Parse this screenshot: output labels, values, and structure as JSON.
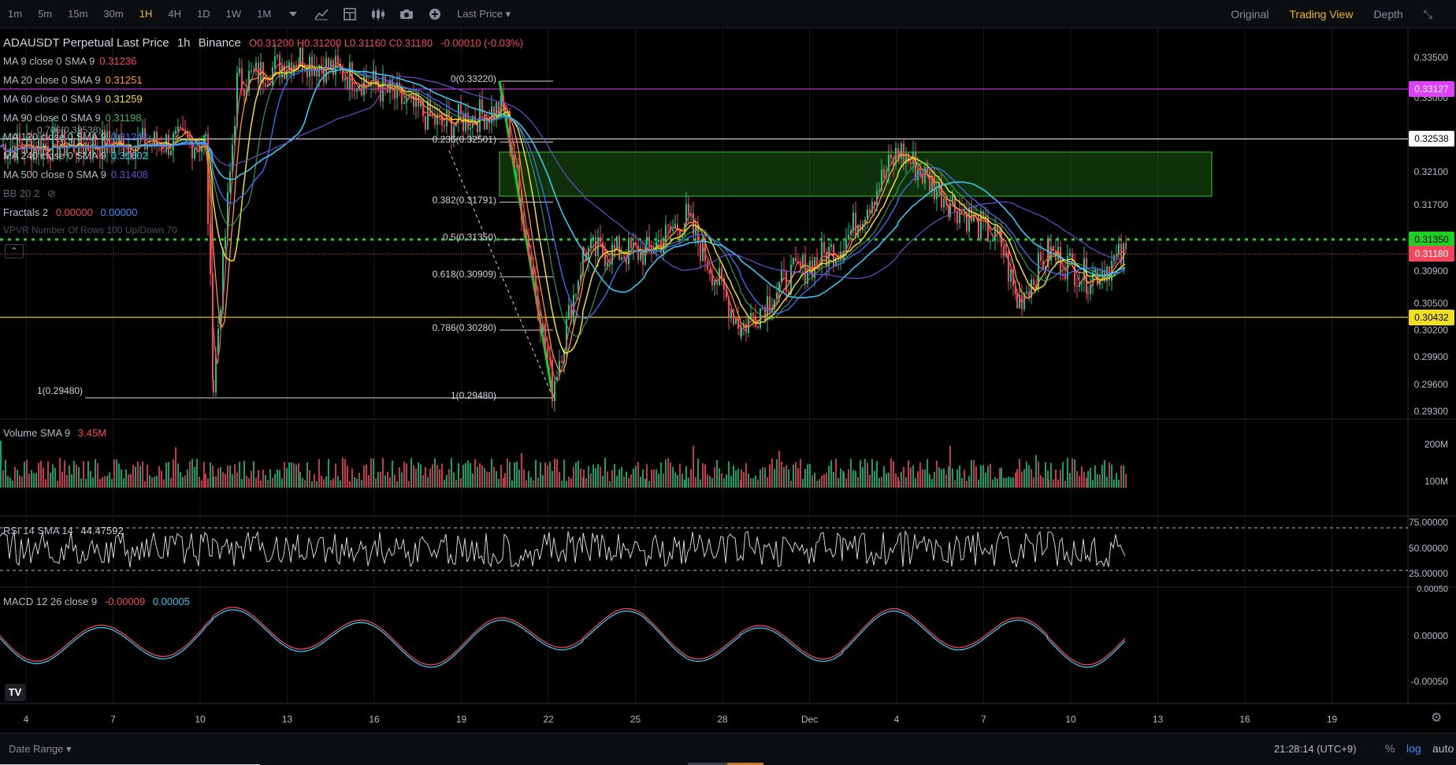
{
  "toolbar": {
    "timeframes": [
      "1m",
      "5m",
      "15m",
      "30m",
      "1H",
      "4H",
      "1D",
      "1W",
      "1M"
    ],
    "active_timeframe": "1H",
    "price_type": "Last Price",
    "views": [
      "Original",
      "Trading View",
      "Depth"
    ],
    "active_view": "Trading View"
  },
  "header": {
    "symbol": "ADAUSDT Perpetual Last Price",
    "interval": "1h",
    "exchange": "Binance",
    "ohlc": "O0.31200 H0.31200 L0.31160 C0.31180",
    "change": "-0.00010 (-0.03%)"
  },
  "legends": [
    {
      "label": "MA 9 close 0 SMA 9",
      "value": "0.31236",
      "color": "#f6465d"
    },
    {
      "label": "MA 20 close 0 SMA 9",
      "value": "0.31251",
      "color": "#ff9a1f"
    },
    {
      "label": "MA 60 close 0 SMA 9",
      "value": "0.31259",
      "color": "#f0e020"
    },
    {
      "label": "MA 90 close 0 SMA 9",
      "value": "0.31198",
      "color": "#37b45a"
    },
    {
      "label": "MA 120 close 0 SMA 9",
      "value": "0.31243",
      "color": "#3b6cf0"
    },
    {
      "label": "MA 240 close 0 SMA 9",
      "value": "0.31602",
      "color": "#33c9f0"
    },
    {
      "label": "MA 500 close 0 SMA 9",
      "value": "0.31408",
      "color": "#6a4fd0"
    }
  ],
  "bb_label": "BB 20 2",
  "fractals": {
    "label": "Fractals 2",
    "v1": "0.00000",
    "v2": "0.00000"
  },
  "vpvr_label": "VPVR Number Of Rows 100 Up/Down 70",
  "fib_left": [
    {
      "label": "0.786(0.32538)"
    },
    {
      "label": "1(0.29480)"
    }
  ],
  "fib": [
    {
      "label": "0(0.33220)",
      "price": 0.3322
    },
    {
      "label": "0.236(0.32501)",
      "price": 0.32501
    },
    {
      "label": "0.382(0.31791)",
      "price": 0.31791
    },
    {
      "label": "0.5(0.31350)",
      "price": 0.3135
    },
    {
      "label": "0.618(0.30909)",
      "price": 0.30909
    },
    {
      "label": "0.786(0.30280)",
      "price": 0.3028
    },
    {
      "label": "1(0.29480)",
      "price": 0.2948
    }
  ],
  "price_axis": [
    "0.33500",
    "0.33000",
    "0.32100",
    "0.31700",
    "0.30900",
    "0.30500",
    "0.30200",
    "0.29900",
    "0.29600",
    "0.29300"
  ],
  "price_tags": [
    {
      "text": "0.33127",
      "bg": "#e040fb",
      "color": "#ffffff",
      "price": 0.33127
    },
    {
      "text": "0.32538",
      "bg": "#ffffff",
      "color": "#000000",
      "price": 0.32538
    },
    {
      "text": "0.31350",
      "bg": "#20d020",
      "color": "#000000",
      "price": 0.3135
    },
    {
      "text": "0.31180",
      "bg": "#f6465d",
      "color": "#ffffff",
      "price": 0.3118
    },
    {
      "text": "0.30432",
      "bg": "#f0e020",
      "color": "#000000",
      "price": 0.30432
    }
  ],
  "volume": {
    "label": "Volume SMA 9",
    "value": "3.45M",
    "axis": [
      "200M",
      "100M"
    ]
  },
  "rsi": {
    "label": "RSI 14 SMA 14",
    "value": "44.47592",
    "axis": [
      "75.00000",
      "50.00000",
      "25.00000"
    ]
  },
  "macd": {
    "label": "MACD 12 26 close 9",
    "v1": "-0.00009",
    "v2": "0.00005",
    "axis": [
      "0.00000",
      "-0.00050"
    ],
    "top_axis": "0.00050"
  },
  "x_axis": [
    "4",
    "7",
    "10",
    "13",
    "16",
    "19",
    "22",
    "25",
    "28",
    "Dec",
    "4",
    "7",
    "10",
    "13",
    "16",
    "19"
  ],
  "bottom": {
    "date_range": "Date Range",
    "clock": "21:28:14 (UTC+9)",
    "pct": "%",
    "log": "log",
    "auto": "auto"
  },
  "colors": {
    "up": "#0ecb81",
    "down": "#f6465d",
    "bg": "#000000"
  }
}
